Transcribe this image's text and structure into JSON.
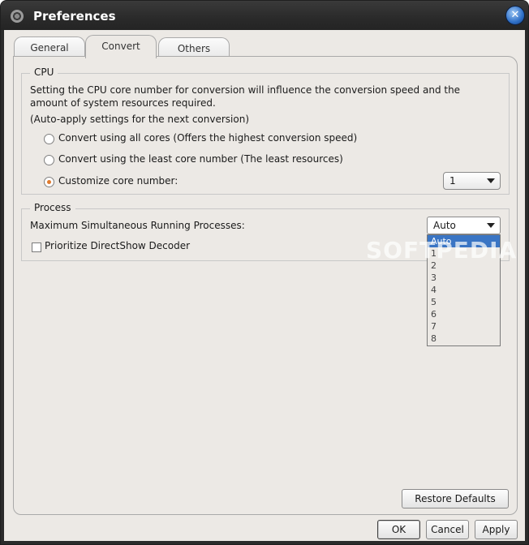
{
  "window": {
    "title": "Preferences",
    "close_glyph": "✕"
  },
  "tabs": [
    {
      "label": "General"
    },
    {
      "label": "Convert"
    },
    {
      "label": "Others"
    }
  ],
  "active_tab": "Convert",
  "cpu": {
    "title": "CPU",
    "description": "Setting the CPU core number for conversion will influence the conversion speed and the amount of system resources required.",
    "note": "(Auto-apply settings for the next conversion)",
    "options": [
      {
        "label": "Convert using all cores (Offers the highest conversion speed)",
        "checked": false
      },
      {
        "label": "Convert using the least core number (The least resources)",
        "checked": false
      },
      {
        "label": "Customize core number:",
        "checked": true
      }
    ],
    "core_number_value": "1"
  },
  "process": {
    "title": "Process",
    "max_label": "Maximum Simultaneous Running Processes:",
    "max_value": "Auto",
    "dropdown_options": [
      "Auto",
      "1",
      "2",
      "3",
      "4",
      "5",
      "6",
      "7",
      "8"
    ],
    "selected_option": "Auto",
    "prioritize_label": "Prioritize DirectShow Decoder",
    "prioritize_checked": false
  },
  "watermark": "SOFTPEDIA",
  "buttons": {
    "restore_defaults": "Restore Defaults",
    "ok": "OK",
    "cancel": "Cancel",
    "apply": "Apply"
  },
  "colors": {
    "titlebar": "#2b2b2b",
    "selection": "#3a75c4",
    "radio_dot": "#e07a2d"
  }
}
